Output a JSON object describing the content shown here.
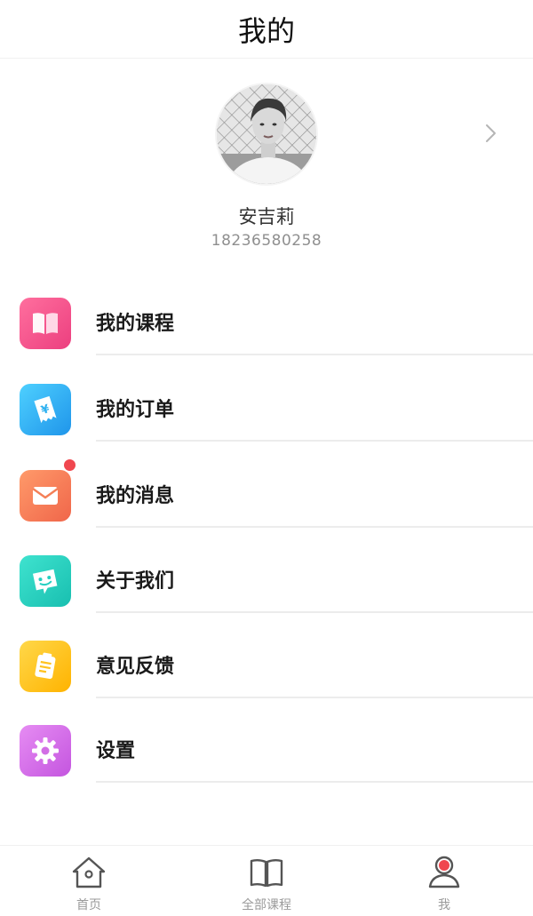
{
  "header": {
    "title": "我的"
  },
  "profile": {
    "name": "安吉莉",
    "phone": "18236580258",
    "chevron_icon": "chevron-right-icon"
  },
  "menu": [
    {
      "label": "我的课程",
      "icon": "book-icon",
      "color": "#f2558f"
    },
    {
      "label": "我的订单",
      "icon": "receipt-icon",
      "color": "#2fb1f0"
    },
    {
      "label": "我的消息",
      "icon": "envelope-icon",
      "color": "#f47f57",
      "has_badge": true
    },
    {
      "label": "关于我们",
      "icon": "smile-chat-icon",
      "color": "#24cfc1"
    },
    {
      "label": "意见反馈",
      "icon": "clipboard-icon",
      "color": "#ffc21e"
    },
    {
      "label": "设置",
      "icon": "gear-icon",
      "color": "#d26ee5"
    }
  ],
  "tabs": [
    {
      "label": "首页",
      "icon": "home-icon",
      "active": false
    },
    {
      "label": "全部课程",
      "icon": "book-outline-icon",
      "active": false
    },
    {
      "label": "我",
      "icon": "person-icon",
      "active": true
    }
  ],
  "colors": {
    "badge": "#f0474f",
    "tab_active_accent": "#f0474f",
    "tab_text": "#9a9a9a"
  }
}
